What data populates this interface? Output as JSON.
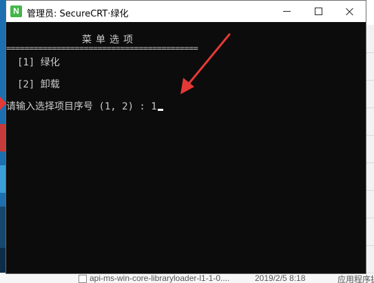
{
  "window": {
    "title": "管理员: SecureCRT·绿化",
    "app_icon_letter": "N"
  },
  "console": {
    "menu_title": "菜单选项",
    "separator": "==========================================",
    "options": [
      {
        "label": "[1] 绿化"
      },
      {
        "label": "[2] 卸载"
      }
    ],
    "prompt": "请输入选择项目序号 (1, 2) : ",
    "input_value": "1"
  },
  "background": {
    "file_name": "api-ms-win-core-libraryloader-l1-1-0....",
    "file_date": "2019/2/5 8:18",
    "file_type": "应用程序扩"
  },
  "colors": {
    "console_bg": "#0c0c0c",
    "console_text": "#cccccc",
    "annotation_arrow": "#e53935",
    "app_icon": "#43b649"
  }
}
